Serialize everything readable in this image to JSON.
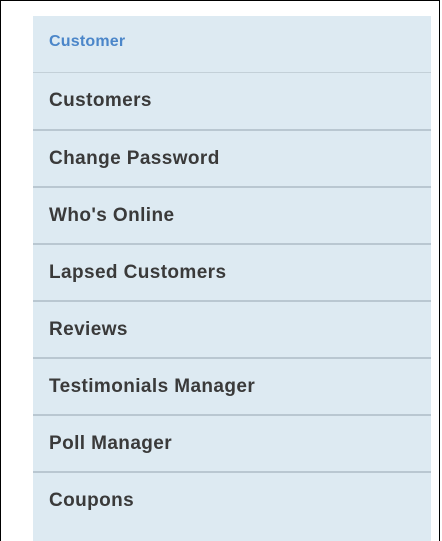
{
  "section": {
    "title": "Customer"
  },
  "menu": {
    "items": [
      {
        "label": "Customers"
      },
      {
        "label": "Change Password"
      },
      {
        "label": "Who's Online"
      },
      {
        "label": "Lapsed Customers"
      },
      {
        "label": "Reviews"
      },
      {
        "label": "Testimonials Manager"
      },
      {
        "label": "Poll Manager"
      },
      {
        "label": "Coupons"
      }
    ]
  },
  "colors": {
    "panel_background": "#ddeaf2",
    "title_text": "#4b86c9",
    "item_text": "#3a3a3a",
    "separator": "#b9c7d1"
  }
}
